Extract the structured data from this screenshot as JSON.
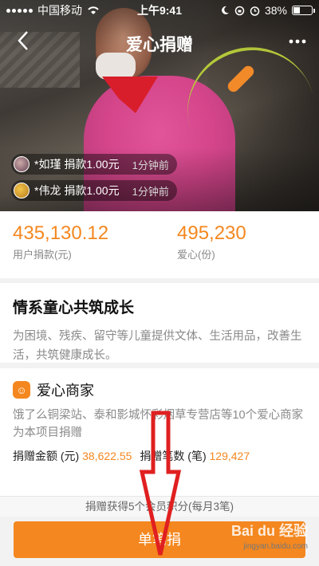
{
  "status_bar": {
    "carrier": "中国移动",
    "time": "上午9:41",
    "battery": "38%",
    "battery_level": 0.38
  },
  "nav": {
    "back_icon": "chevron-left-icon",
    "title": "爱心捐赠",
    "more_icon": "more-dots-icon"
  },
  "tickers": [
    {
      "name": "*如瑾 捐款1.00元",
      "ago": "1分钟前"
    },
    {
      "name": "*伟龙 捐款1.00元",
      "ago": "1分钟前"
    }
  ],
  "stats": [
    {
      "value": "435,130.12",
      "label": "用户捐款(元)"
    },
    {
      "value": "495,230",
      "label": "爱心(份)"
    }
  ],
  "project": {
    "title": "情系童心共筑成长",
    "description": "为困境、残疾、留守等儿童提供文体、生活用品，改善生活，共筑健康成长。"
  },
  "merchant": {
    "title": "爱心商家",
    "description": "饿了么铜梁站、泰和影城怀彩烟草专营店等10个爱心商家为本项目捐赠",
    "amount_label": "捐赠金额 (元)",
    "amount_value": "38,622.55",
    "count_label": "捐赠笔数 (笔)",
    "count_value": "129,427"
  },
  "footer": {
    "points_note": "捐赠获得5个会员积分(每月3笔)",
    "donate_button": "单笔捐"
  },
  "watermark": {
    "brand": "Bai du 经验",
    "url": "jingyan.baidu.com"
  },
  "colors": {
    "accent": "#f4871f",
    "arrow": "#e02020"
  }
}
